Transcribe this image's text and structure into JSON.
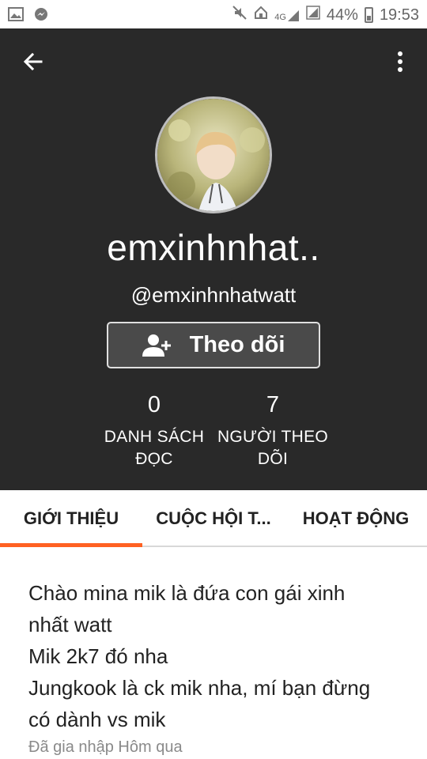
{
  "status_bar": {
    "battery_percent": "44%",
    "time": "19:53",
    "network": "4G",
    "left_icons": [
      "image-icon",
      "messenger-icon"
    ],
    "right_icons": [
      "mute-icon",
      "home-icon",
      "signal-4g-icon",
      "signal-icon",
      "battery-icon"
    ]
  },
  "header": {
    "background": "#292929",
    "display_name": "emxinhnhat..",
    "username": "@emxinhnhatwatt",
    "follow_button_label": "Theo dõi",
    "stats": [
      {
        "value": "0",
        "label": "DANH SÁCH ĐỌC"
      },
      {
        "value": "7",
        "label": "NGƯỜI THEO DÕI"
      }
    ]
  },
  "tabs": [
    {
      "label": "GIỚI THIỆU",
      "active": true
    },
    {
      "label": "CUỘC HỘI T...",
      "active": false
    },
    {
      "label": "HOẠT ĐỘNG",
      "active": false
    }
  ],
  "accent_color": "#ff6122",
  "about": {
    "bio_lines": [
      "Chào mina mik là đứa con gái xinh",
      "nhất watt",
      "Mik 2k7 đó nha",
      "Jungkook là ck mik nha, mí bạn đừng",
      "có dành vs mik"
    ],
    "joined": "Đã gia nhập Hôm qua"
  }
}
